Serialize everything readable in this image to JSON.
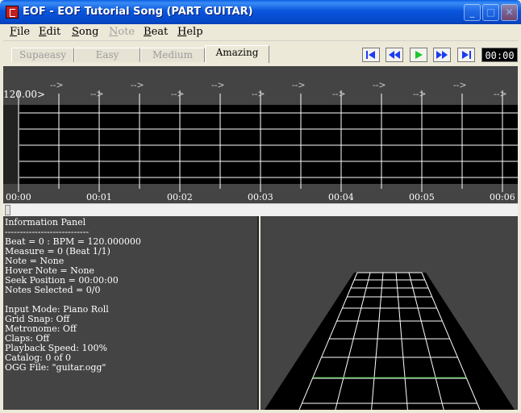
{
  "window": {
    "title": "EOF - EOF Tutorial Song (PART GUITAR)",
    "minimize_glyph": "_",
    "maximize_glyph": "□",
    "close_glyph": "✕"
  },
  "menu": [
    {
      "key": "file",
      "first": "F",
      "rest": "ile",
      "enabled": true
    },
    {
      "key": "edit",
      "first": "E",
      "rest": "dit",
      "enabled": true
    },
    {
      "key": "song",
      "first": "S",
      "rest": "ong",
      "enabled": true
    },
    {
      "key": "note",
      "first": "N",
      "rest": "ote",
      "enabled": false
    },
    {
      "key": "beat",
      "first": "B",
      "rest": "eat",
      "enabled": true
    },
    {
      "key": "help",
      "first": "H",
      "rest": "elp",
      "enabled": true
    }
  ],
  "difficulty_tabs": [
    {
      "label": "Supaeasy",
      "active": false
    },
    {
      "label": "Easy",
      "active": false
    },
    {
      "label": "Medium",
      "active": false
    },
    {
      "label": "Amazing",
      "active": true
    }
  ],
  "transport": {
    "buttons": [
      "skip-to-start-icon",
      "rewind-icon",
      "play-icon",
      "fast-forward-icon",
      "skip-to-end-icon"
    ],
    "time": "00:00",
    "accent": "#1a3cf0",
    "play_color": "#18c828"
  },
  "editor": {
    "bpm_marker": "120.00>",
    "beat_arrow": "-->",
    "beat_arrow_count": 12,
    "time_labels": [
      "00:00",
      "00:01",
      "00:02",
      "00:03",
      "00:04",
      "00:05",
      "00:06"
    ]
  },
  "info_panel": {
    "lines": [
      "Information Panel",
      "----------------------------",
      "Beat = 0 : BPM = 120.000000",
      "Measure = 0 (Beat 1/1)",
      "Note = None",
      "Hover Note = None",
      "Seek Position = 00:00:00",
      "Notes Selected = 0/0",
      "",
      "Input Mode: Piano Roll",
      "Grid Snap: Off",
      "Metronome: Off",
      "Claps: Off",
      "Playback Speed: 100%",
      "Catalog: 0 of 0",
      "OGG File: \"guitar.ogg\""
    ]
  },
  "colors": {
    "panel_bg": "#444444",
    "highway_bg": "#000000",
    "grid_line": "#ffffff",
    "strike_line": "#1f9a1f"
  }
}
